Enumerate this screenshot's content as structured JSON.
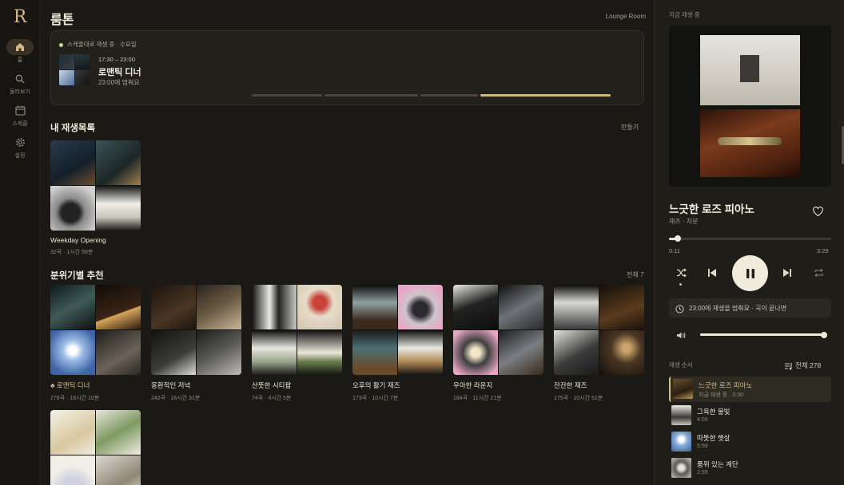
{
  "brand": {
    "logo": "R"
  },
  "nav": [
    {
      "name": "home",
      "label": "홈",
      "icon": "home-icon",
      "active": true
    },
    {
      "name": "browse",
      "label": "둘러보기",
      "icon": "search-icon",
      "active": false
    },
    {
      "name": "schedule",
      "label": "스케줄",
      "icon": "calendar-icon",
      "active": false
    },
    {
      "name": "settings",
      "label": "설정",
      "icon": "gear-icon",
      "active": false
    }
  ],
  "header": {
    "title": "룸톤",
    "room": "Lounge Room"
  },
  "banner": {
    "status": "스케줄대로 재생 중 · 수요일",
    "time": "17:30 – 23:00",
    "name": "로맨틱 디너",
    "stop": "23:00에 멈춰요",
    "status_color": "#b9ddaa"
  },
  "my_playlists": {
    "title": "내 재생목록",
    "action": "만들기",
    "items": [
      {
        "name": "Weekday Opening",
        "meta": "32곡 · 1시간 58분"
      }
    ]
  },
  "moods": {
    "title": "분위기별 추천",
    "action": "전체 7",
    "items": [
      {
        "name": "♣ 로맨틱 디너",
        "meta": "278곡 · 18시간 10분",
        "highlight": true
      },
      {
        "name": "몽환적인 저녁",
        "meta": "242곡 · 16시간 31분"
      },
      {
        "name": "산뜻한 시티팝",
        "meta": "74곡 · 4시간 5분"
      },
      {
        "name": "오후의 활기 재즈",
        "meta": "173곡 · 10시간 7분"
      },
      {
        "name": "우아한 라운지",
        "meta": "184곡 · 11시간 21분"
      },
      {
        "name": "잔잔한 재즈",
        "meta": "175곡 · 10시간 51분"
      }
    ]
  },
  "player": {
    "label": "지금 재생 중",
    "title": "느긋한 로즈 피아노",
    "subtitle": "재즈 · 차분",
    "elapsed": "0:11",
    "total": "3:29",
    "progress": 0.053,
    "volume": 1.0,
    "stop_notice": "23:00에 재생을 멈춰요 · 곡이 끝나면",
    "accent": "#d6b884"
  },
  "queue": {
    "label": "재생 순서",
    "count": "전체 278",
    "items": [
      {
        "title": "느긋한 로즈 피아노",
        "meta": "지금 재생 중 · 3:30",
        "current": true
      },
      {
        "title": "그윽한 불빛",
        "meta": "4:00"
      },
      {
        "title": "따뜻한 햇살",
        "meta": "5:59"
      },
      {
        "title": "품위 있는 계단",
        "meta": "2:59"
      }
    ]
  }
}
